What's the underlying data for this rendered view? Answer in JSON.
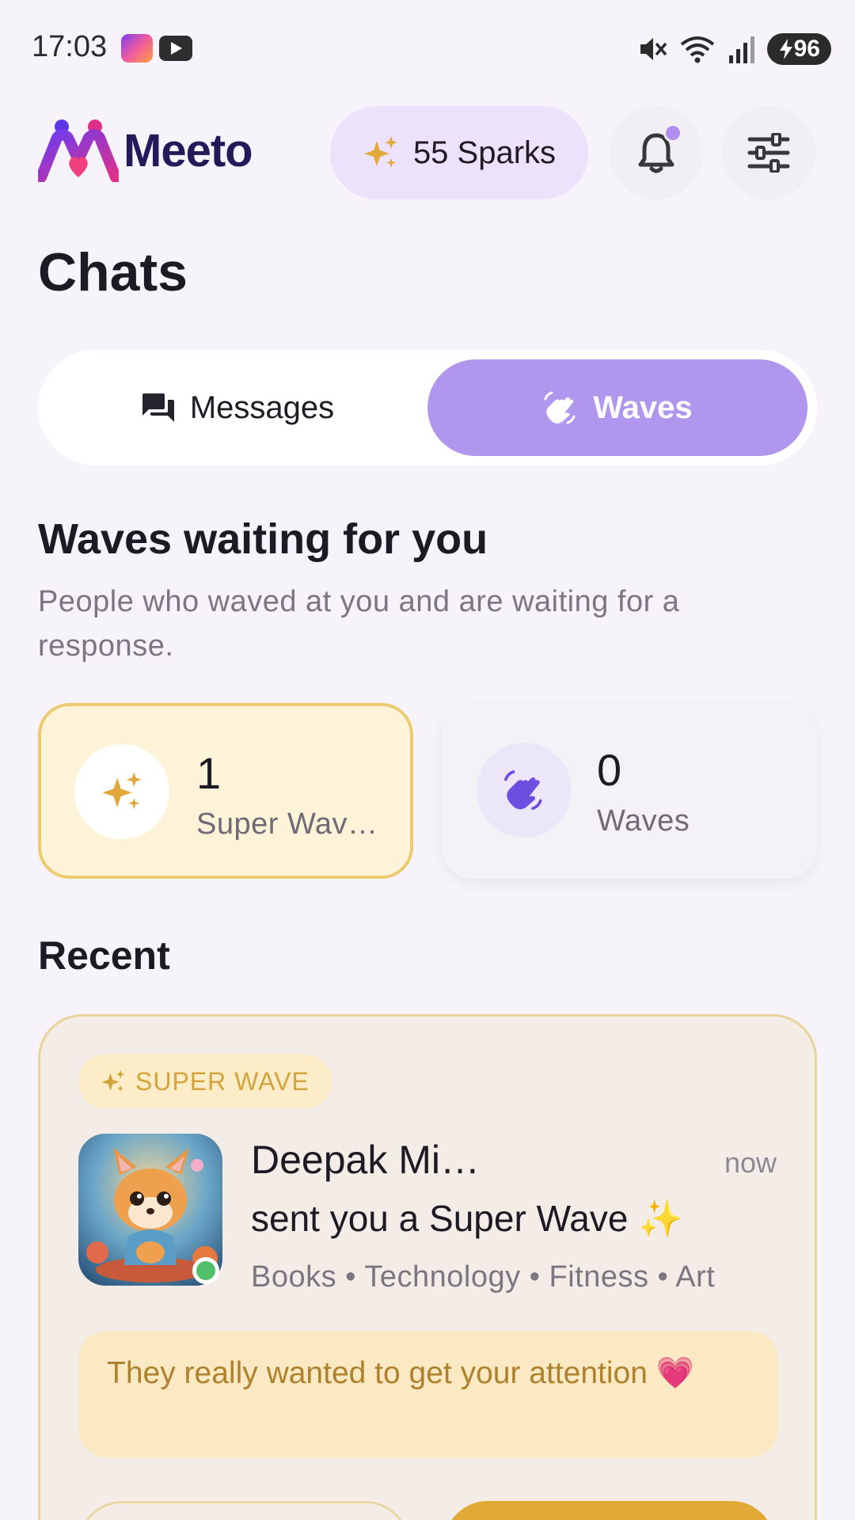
{
  "status_bar": {
    "time": "17:03",
    "battery": "96",
    "icons": [
      "meeto-app-icon",
      "youtube-icon",
      "mute-icon",
      "wifi-icon",
      "signal-icon",
      "battery-charging-icon"
    ]
  },
  "header": {
    "logo_text": "Meeto",
    "sparks_label": "55 Sparks",
    "colors": {
      "accent": "#b196ee",
      "gold": "#e1aa35",
      "logo_dark": "#241a5a"
    }
  },
  "page_title": "Chats",
  "tabs": [
    {
      "label": "Messages",
      "icon": "chat-bubbles-icon",
      "active": false
    },
    {
      "label": "Waves",
      "icon": "waving-hand-icon",
      "active": true
    }
  ],
  "waves_section": {
    "heading": "Waves waiting for you",
    "subtitle": "People who waved at you and are waiting for a response.",
    "stats": [
      {
        "count": "1",
        "label": "Super Wav…",
        "icon": "sparkles-icon"
      },
      {
        "count": "0",
        "label": "Waves",
        "icon": "waving-hand-icon"
      }
    ]
  },
  "recent": {
    "heading": "Recent",
    "items": [
      {
        "badge": "SUPER WAVE",
        "name": "Deepak Mi…",
        "time": "now",
        "message": "sent you a Super Wave ✨",
        "interests": "Books • Technology • Fitness • Art",
        "note": "They really wanted to get your attention 💗",
        "online": true
      }
    ]
  }
}
